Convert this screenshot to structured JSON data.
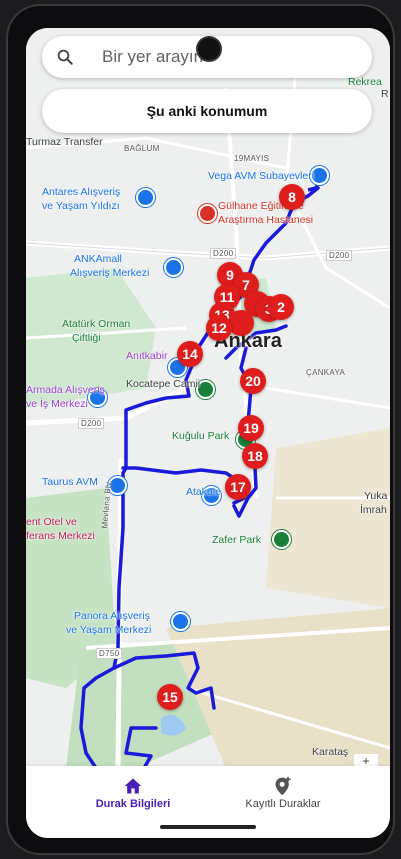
{
  "search": {
    "placeholder": "Bir yer arayın"
  },
  "location_button": {
    "label": "Şu anki konumum"
  },
  "map": {
    "labels": {
      "bagdat": "BAĞLUM",
      "maltepe_top": "Turmaz Transfer",
      "mayis": "19MAYIS",
      "vega": "Vega AVM Subayevleri",
      "antares_1": "Antares Alışveriş",
      "antares_2": "ve Yaşam Yıldızı",
      "gulhane_1": "Gülhane Eğitim ve",
      "gulhane_2": "Araştırma Hastanesi",
      "d200_a": "D200",
      "d200_b": "D200",
      "d200_c": "D200",
      "ankamall_1": "ANKAmall",
      "ankamall_2": "Alışveriş Merkezi",
      "ataturk_1": "Atatürk Orman",
      "ataturk_2": "Çiftliği",
      "anitkabir": "Anıtkabir",
      "city": "Ankara",
      "cankaya": "ÇANKAYA",
      "armada_1": "Armada Alışveriş",
      "armada_2": "ve İş Merkezi",
      "kocatepe": "Kocatepe Camii",
      "kugulu": "Kuğulu Park",
      "taurus": "Taurus AVM",
      "atakule": "Atakule",
      "otel_1": "ent Otel ve",
      "otel_2": "ferans Merkezi",
      "zafer": "Zafer Park",
      "yuka_1": "Yuka",
      "yuka_2": "İmrah",
      "mevlana": "Mevlana Blv.",
      "panora_1": "Panora Alışveriş",
      "panora_2": "ve Yaşam Merkezi",
      "d750": "D750",
      "karatas": "Karataş",
      "rekrea": "Rekrea",
      "rn": "R"
    },
    "stops": [
      "8",
      "9",
      "7",
      "11",
      "3",
      "2",
      "13",
      "12",
      "14",
      "20",
      "19",
      "18",
      "17",
      "15"
    ],
    "route_color": "#1a1adb",
    "stop_color": "#e01d1d"
  },
  "nav": {
    "items": [
      {
        "label": "Durak Bilgileri",
        "icon": "home-icon",
        "active": true
      },
      {
        "label": "Kayıtlı Duraklar",
        "icon": "add-location-icon",
        "active": false
      }
    ],
    "active_color": "#4a1fb8"
  }
}
